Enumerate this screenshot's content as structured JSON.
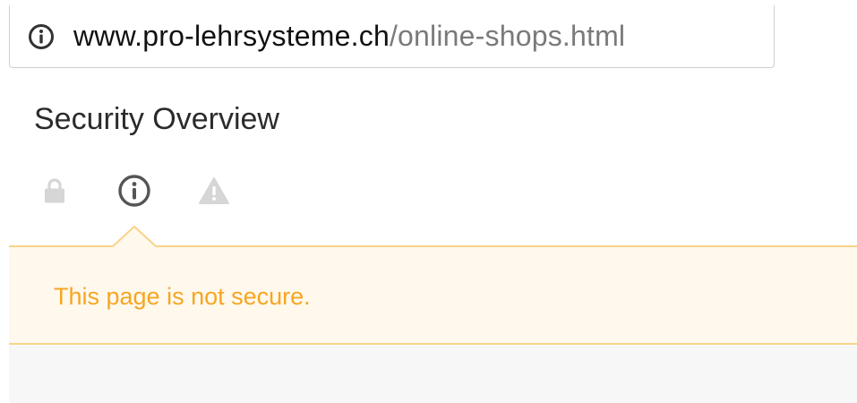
{
  "address_bar": {
    "url_host": "www.pro-lehrsysteme.ch",
    "url_path": "/online-shops.html",
    "icon": "info-circle-icon"
  },
  "security_overview": {
    "title": "Security Overview",
    "icons": [
      {
        "name": "lock-icon",
        "state": "inactive"
      },
      {
        "name": "info-circle-icon",
        "state": "active"
      },
      {
        "name": "warning-icon",
        "state": "inactive"
      }
    ],
    "message": "This page is not secure."
  },
  "colors": {
    "warning_text": "#f5a623",
    "panel_background": "#fff8ec",
    "panel_border": "#f8d38a",
    "inactive_icon": "#d6d6d6",
    "active_icon": "#555555"
  }
}
